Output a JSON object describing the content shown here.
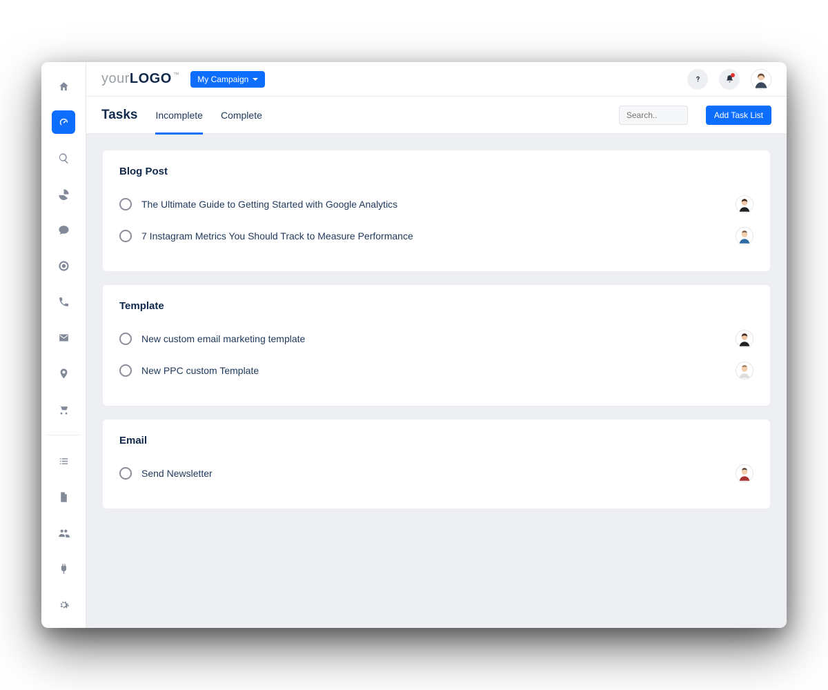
{
  "logo": {
    "part1": "your",
    "part2": "LOGO",
    "tm": "™"
  },
  "campaign": {
    "label": "My Campaign"
  },
  "search": {
    "placeholder": "Search.."
  },
  "add_task_list": "Add Task List",
  "page_title": "Tasks",
  "tabs": {
    "incomplete": "Incomplete",
    "complete": "Complete"
  },
  "sidebar": {
    "items": [
      {
        "name": "home"
      },
      {
        "name": "dashboard",
        "active": true
      },
      {
        "name": "search"
      },
      {
        "name": "analytics"
      },
      {
        "name": "chat"
      },
      {
        "name": "target"
      },
      {
        "name": "phone"
      },
      {
        "name": "mail"
      },
      {
        "name": "location"
      },
      {
        "name": "cart"
      },
      {
        "name": "tasks"
      },
      {
        "name": "file"
      },
      {
        "name": "users"
      },
      {
        "name": "plug"
      },
      {
        "name": "settings"
      }
    ]
  },
  "lists": [
    {
      "title": "Blog Post",
      "tasks": [
        {
          "label": "The Ultimate Guide to Getting Started with Google Analytics",
          "avatar_hair": "#422b20",
          "avatar_skin": "#f0c8a5"
        },
        {
          "label": "7 Instagram Metrics You Should Track to Measure Performance",
          "avatar_hair": "#7a5a43",
          "avatar_skin": "#f2cfad"
        }
      ]
    },
    {
      "title": "Template",
      "tasks": [
        {
          "label": "New custom email marketing template",
          "avatar_hair": "#422b20",
          "avatar_skin": "#f0c8a5"
        },
        {
          "label": "New PPC custom Template",
          "avatar_hair": "#a07a58",
          "avatar_skin": "#f2cfad"
        }
      ]
    },
    {
      "title": "Email",
      "tasks": [
        {
          "label": "Send Newsletter",
          "avatar_hair": "#593d2e",
          "avatar_skin": "#f2cfad"
        }
      ]
    }
  ]
}
